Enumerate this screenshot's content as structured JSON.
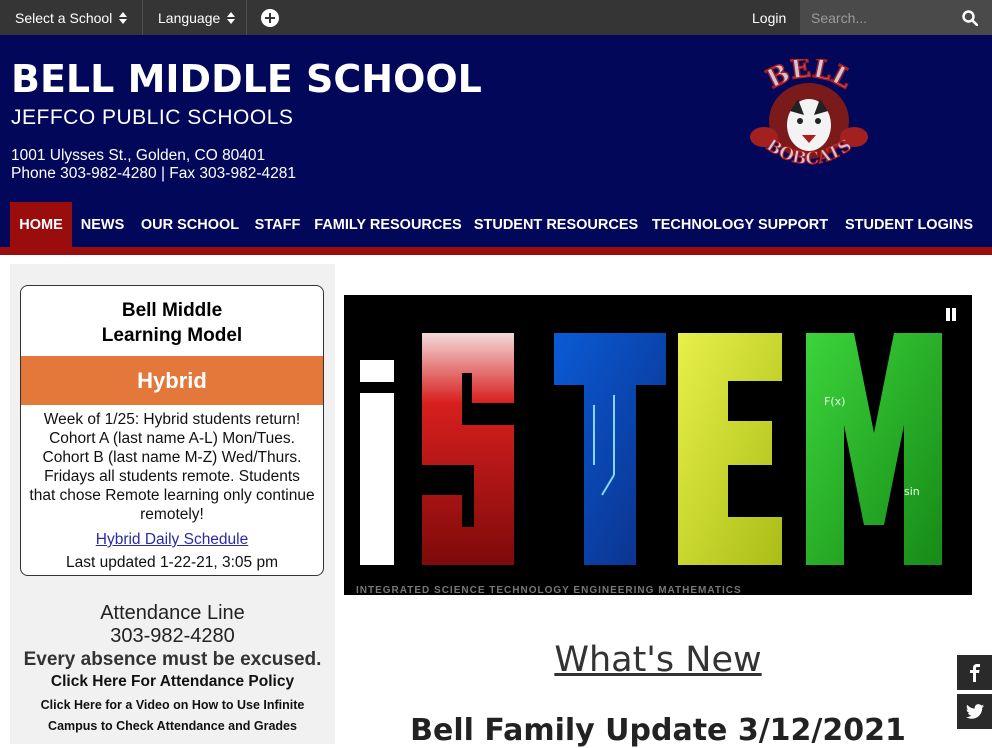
{
  "utility_bar": {
    "select_school": "Select a School",
    "language": "Language",
    "login": "Login",
    "search_placeholder": "Search..."
  },
  "header": {
    "school_name": "BELL MIDDLE SCHOOL",
    "district": "JEFFCO PUBLIC SCHOOLS",
    "address_line": "1001 Ulysses St., Golden, CO 80401",
    "phone_line": "Phone 303-982-4280 | Fax 303-982-4281",
    "logo_top_text": "BELL",
    "logo_bottom_text": "BOBCATS"
  },
  "nav": {
    "items": [
      {
        "label": "HOME",
        "active": true
      },
      {
        "label": "NEWS"
      },
      {
        "label": "OUR SCHOOL"
      },
      {
        "label": "STAFF"
      },
      {
        "label": "FAMILY RESOURCES"
      },
      {
        "label": "STUDENT RESOURCES"
      },
      {
        "label": "TECHNOLOGY SUPPORT"
      },
      {
        "label": "STUDENT LOGINS"
      }
    ]
  },
  "learning_card": {
    "title_line1": "Bell Middle",
    "title_line2": "Learning Model",
    "model": "Hybrid",
    "body": "Week of 1/25: Hybrid students return! Cohort A (last name A-L) Mon/Tues. Cohort B (last name M-Z) Wed/Thurs. Fridays all students remote. Students that chose Remote learning only continue remotely!",
    "schedule_link": "Hybrid Daily Schedule",
    "updated": "Last updated 1-22-21, 3:05 pm"
  },
  "attendance": {
    "title": "Attendance Line",
    "phone": "303-982-4280",
    "excused": "Every absence must be excused.",
    "policy_link": "Click Here For Attendance Policy",
    "video_link_line1": "Click Here for a Video on How to Use Infinite",
    "video_link_line2": "Campus to Check Attendance and Grades"
  },
  "hero": {
    "banner_text": "STEM",
    "caption": "INTEGRATED SCIENCE TECHNOLOGY ENGINEERING MATHEMATICS"
  },
  "main": {
    "whats_new": "What's New",
    "headline": "Bell Family Update 3/12/2021"
  },
  "colors": {
    "utility_bg": "#353535",
    "header_bg": "#03075a",
    "accent_red": "#9b0d0d",
    "hybrid_orange": "#e4773a",
    "sidebar_bg": "#f1f1f1"
  },
  "icons": [
    "updown-arrows-icon",
    "plus-circle-icon",
    "search-icon",
    "pause-icon",
    "facebook-icon",
    "twitter-icon"
  ]
}
